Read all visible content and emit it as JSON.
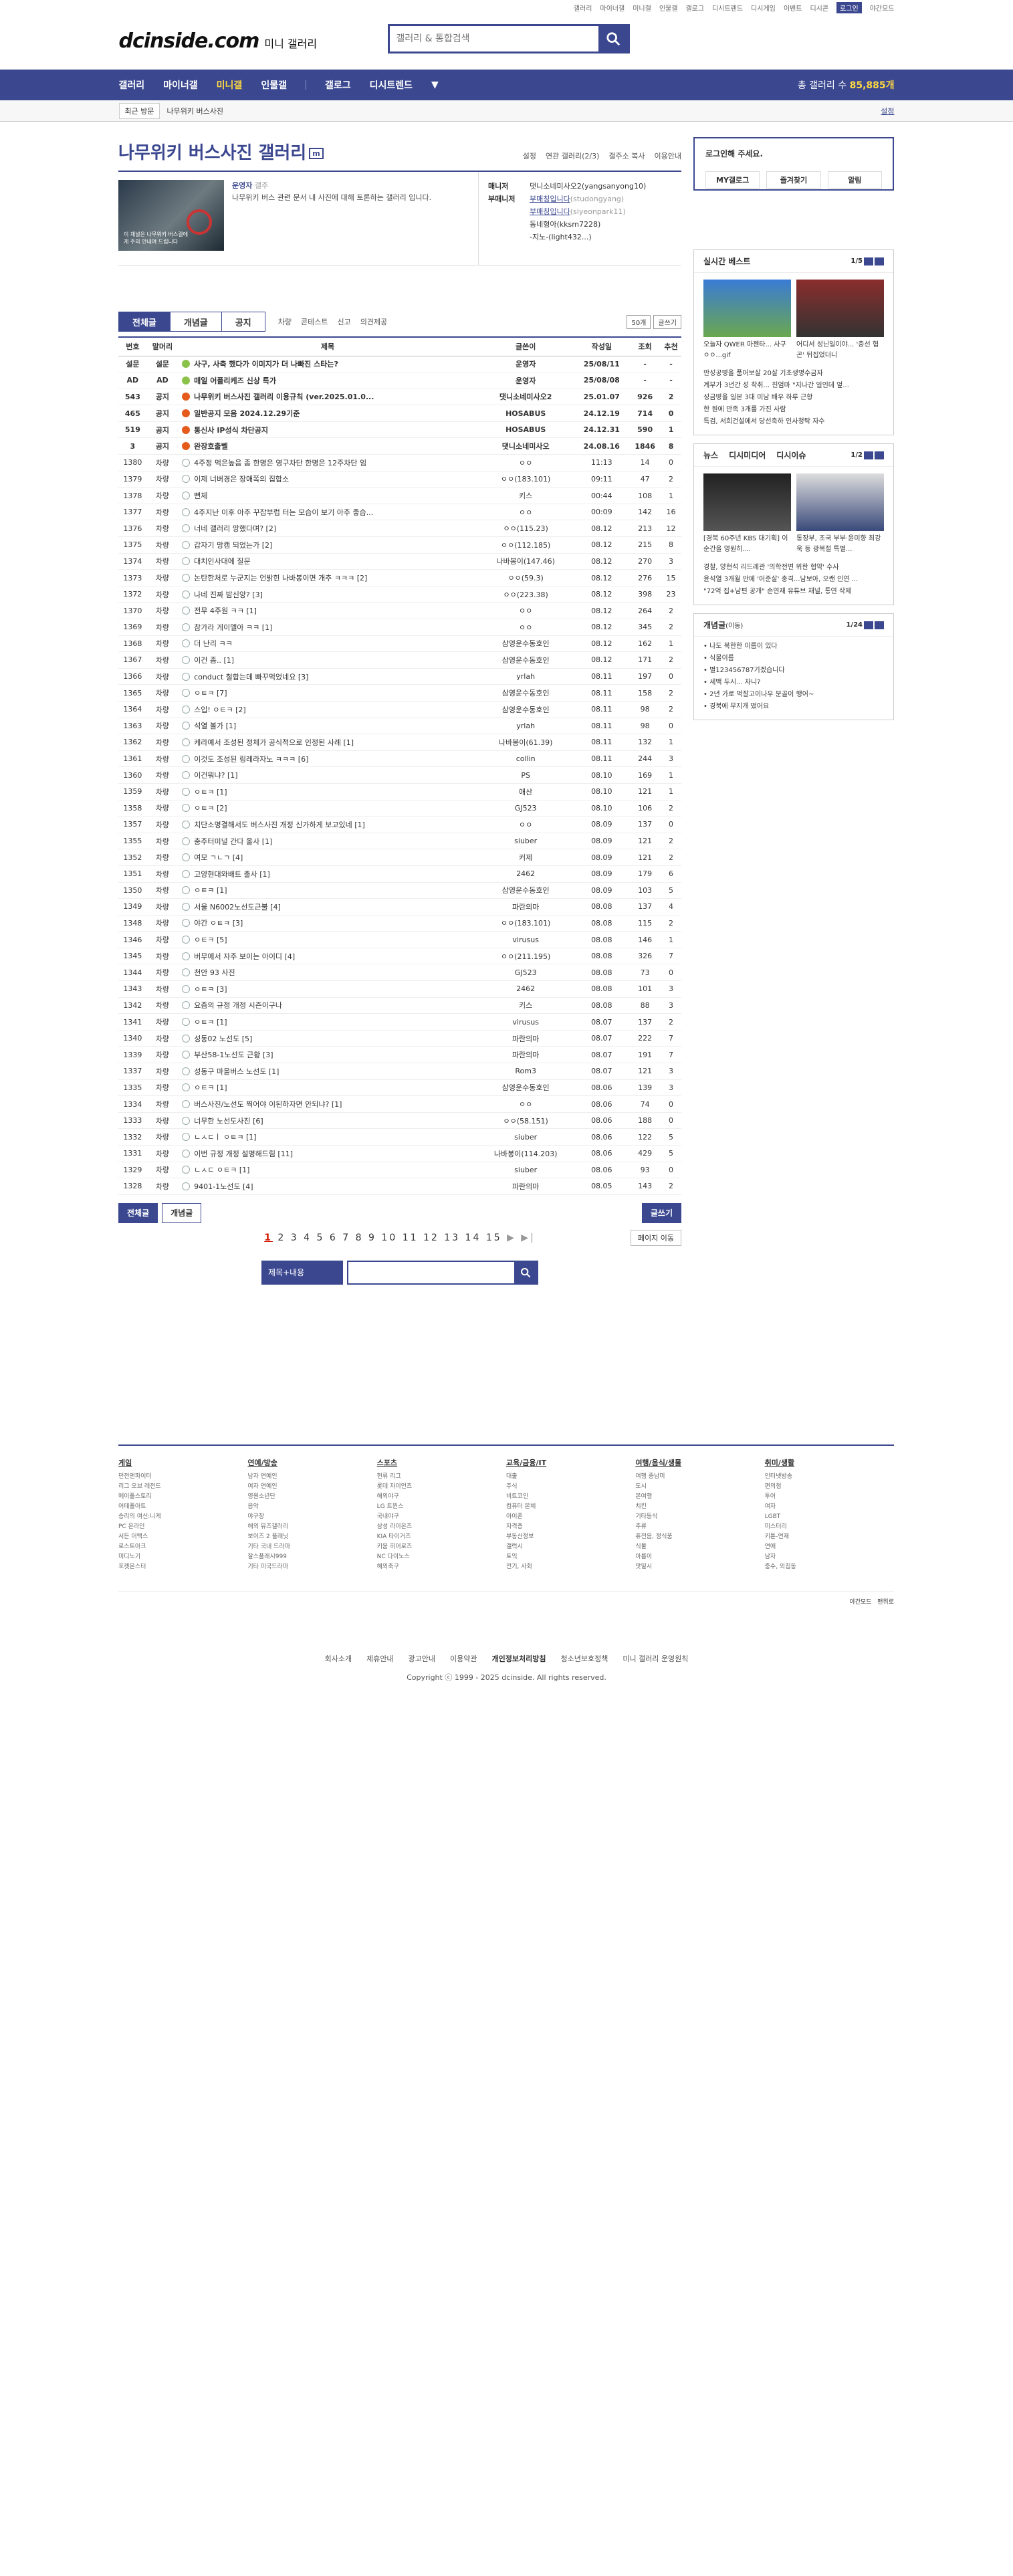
{
  "topbar": {
    "links": [
      "갤러리",
      "마이너갤",
      "미니갤",
      "인물갤",
      "갤로그",
      "디시트렌드",
      "디시게임",
      "이벤트",
      "디시콘"
    ],
    "login": "로그인",
    "night": "야간모드"
  },
  "header": {
    "logo": "dcinside.com",
    "logo_sub": "미니 갤러리",
    "search_placeholder": "갤러리 & 통합검색"
  },
  "gnb": {
    "items": [
      "갤러리",
      "마이너갤",
      "미니갤",
      "인물갤",
      "갤로그",
      "디시트렌드"
    ],
    "active": 2,
    "count_label": "총 갤러리 수",
    "count": "85,885개"
  },
  "crumb": {
    "recent": "최근 방문",
    "current": "나무위키 버스사진",
    "setting": "설정"
  },
  "gallery": {
    "title": "나무위키 버스사진 갤러리",
    "mini": "m",
    "tools": [
      "설정",
      "연관 갤러리(2/3)",
      "갤주소 복사",
      "이용안내"
    ],
    "manager_label": "운영자",
    "manager_sub": "갤주",
    "desc": "나무위키 버스 관련 문서 내 사진에 대해 토론하는 갤러리 입니다.",
    "thumb_caption": "이 채널은 나무위키 버스갤에게 주의 안내여 드립니다",
    "staff": {
      "manager_label": "매니저",
      "manager": "댓니소네미사오2(yangsanyong10)",
      "sub_label": "부매니저",
      "subs": [
        "부매칭입니다",
        "부매칭입니다",
        "동네형아(kksm7228)",
        "-지노-(light432...)"
      ],
      "sub_ids": [
        "(studongyang)",
        "(siyeonpark11)"
      ]
    }
  },
  "tabs": {
    "items": [
      "전체글",
      "개념글",
      "공지"
    ],
    "sub": [
      "차량",
      "콘테스트",
      "신고",
      "의견제공"
    ],
    "per_page": "50개",
    "write": "글쓰기"
  },
  "table": {
    "headers": [
      "번호",
      "말머리",
      "제목",
      "글쓴이",
      "작성일",
      "조회",
      "추천"
    ],
    "rows": [
      [
        "설문",
        "설문",
        "사구, 사축 했다가 이미지가 더 나빠진 스타는?",
        "운영자",
        "25/08/11",
        "-",
        "-",
        "n",
        "#8bc34a"
      ],
      [
        "AD",
        "AD",
        "매일 어플리케즈 신상 특가",
        "운영자",
        "25/08/08",
        "-",
        "-",
        "n",
        "#8bc34a"
      ],
      [
        "543",
        "공지",
        "나무위키 버스사진 갤러리 이용규칙 (ver.2025.01.0...",
        "댓니소네미사오2",
        "25.01.07",
        "926",
        "2",
        "n",
        "#e45b1b"
      ],
      [
        "465",
        "공지",
        "일반공지 모음 2024.12.29기준",
        "HOSABUS",
        "24.12.19",
        "714",
        "0",
        "n",
        "#e45b1b"
      ],
      [
        "519",
        "공지",
        "통신사 IP성식 차단공지",
        "HOSABUS",
        "24.12.31",
        "590",
        "1",
        "n",
        "#e45b1b"
      ],
      [
        "3",
        "공지",
        "완장호출벨",
        "댓니소네미사오",
        "24.08.16",
        "1846",
        "8",
        "n",
        "#e45b1b"
      ],
      [
        "1380",
        "차량",
        "4주정 먹은높음 좀 한명은 영구차단 한명은 12주차단 임",
        "ㅇㅇ",
        "11:13",
        "14",
        "0",
        "",
        ""
      ],
      [
        "1379",
        "차량",
        "이제 너버경은 장애쪽의 집합소",
        "ㅇㅇ(183.101)",
        "09:11",
        "47",
        "2",
        "",
        ""
      ],
      [
        "1378",
        "차량",
        "뻔체",
        "키스",
        "00:44",
        "108",
        "1",
        "",
        ""
      ],
      [
        "1377",
        "차량",
        "4주지난 이후 아주 꾸잡부럽 터는 모습이 보기 아주 좋습...",
        "ㅇㅇ",
        "00:09",
        "142",
        "16",
        "",
        ""
      ],
      [
        "1376",
        "차량",
        "너네 갤러리 망했다며? [2]",
        "ㅇㅇ(115.23)",
        "08.12",
        "213",
        "12",
        "",
        ""
      ],
      [
        "1375",
        "차량",
        "갑자기 망캠 되었는가 [2]",
        "ㅇㅇ(112.185)",
        "08.12",
        "215",
        "8",
        "",
        ""
      ],
      [
        "1374",
        "차량",
        "대치인사대에 질문",
        "나바봉이(147.46)",
        "08.12",
        "270",
        "3",
        "",
        ""
      ],
      [
        "1373",
        "차량",
        "논탄한처로 누군지는 언밝힌 나바봉이면 개추 ㅋㅋㅋ [2]",
        "ㅇㅇ(59.3)",
        "08.12",
        "276",
        "15",
        "",
        ""
      ],
      [
        "1372",
        "차량",
        "나네 진짜 밤신앙? [3]",
        "ㅇㅇ(223.38)",
        "08.12",
        "398",
        "23",
        "",
        ""
      ],
      [
        "1370",
        "차량",
        "전무 4주원 ㅋㅋ [1]",
        "ㅇㅇ",
        "08.12",
        "264",
        "2",
        "",
        ""
      ],
      [
        "1369",
        "차량",
        "참가라 게이엘아 ㅋㅋ [1]",
        "ㅇㅇ",
        "08.12",
        "345",
        "2",
        "",
        ""
      ],
      [
        "1368",
        "차량",
        "더 난리 ㅋㅋ",
        "삼영운수동호인",
        "08.12",
        "162",
        "1",
        "",
        ""
      ],
      [
        "1367",
        "차량",
        "이건 좀.. [1]",
        "삼영운수동호인",
        "08.12",
        "171",
        "2",
        "",
        ""
      ],
      [
        "1366",
        "차량",
        "conduct 철합는데 빠꾸먹었네요 [3]",
        "yrlah",
        "08.11",
        "197",
        "0",
        "",
        ""
      ],
      [
        "1365",
        "차량",
        "ㅇㅌㅋ [7]",
        "삼영운수동호인",
        "08.11",
        "158",
        "2",
        "",
        ""
      ],
      [
        "1364",
        "차량",
        "스입! ㅇㅌㅋ [2]",
        "삼영운수동호인",
        "08.11",
        "98",
        "2",
        "",
        ""
      ],
      [
        "1363",
        "차량",
        "석열 볼가 [1]",
        "yrlah",
        "08.11",
        "98",
        "0",
        "",
        ""
      ],
      [
        "1362",
        "차량",
        "케라예서 조성된 정체가 공식적으로 인정된 사례 [1]",
        "나바봉이(61.39)",
        "08.11",
        "132",
        "1",
        "",
        ""
      ],
      [
        "1361",
        "차량",
        "이것도 조성된 링레라자노 ㅋㅋㅋ [6]",
        "collin",
        "08.11",
        "244",
        "3",
        "",
        ""
      ],
      [
        "1360",
        "차량",
        "이건뭐냐? [1]",
        "PS",
        "08.10",
        "169",
        "1",
        "",
        ""
      ],
      [
        "1359",
        "차량",
        "ㅇㅌㅋ [1]",
        "애산",
        "08.10",
        "121",
        "1",
        "",
        ""
      ],
      [
        "1358",
        "차량",
        "ㅇㅌㅋ [2]",
        "GJ523",
        "08.10",
        "106",
        "2",
        "",
        ""
      ],
      [
        "1357",
        "차량",
        "치단소명결해서도 버스사진 개정 신가하게 보고있네 [1]",
        "ㅇㅇ",
        "08.09",
        "137",
        "0",
        "",
        ""
      ],
      [
        "1355",
        "차량",
        "충주터미널 간다 올사 [1]",
        "siuber",
        "08.09",
        "121",
        "2",
        "",
        ""
      ],
      [
        "1352",
        "차량",
        "여모 ㄱㄴㄱ [4]",
        "커제",
        "08.09",
        "121",
        "2",
        "",
        ""
      ],
      [
        "1351",
        "차량",
        "고양현대와배트 출사 [1]",
        "2462",
        "08.09",
        "179",
        "6",
        "",
        ""
      ],
      [
        "1350",
        "차량",
        "ㅇㅌㅋ [1]",
        "삼영운수동호인",
        "08.09",
        "103",
        "5",
        "",
        ""
      ],
      [
        "1349",
        "차량",
        "서울 N6002노선도근불 [4]",
        "파란의마",
        "08.08",
        "137",
        "4",
        "",
        ""
      ],
      [
        "1348",
        "차량",
        "야간 ㅇㅌㅋ [3]",
        "ㅇㅇ(183.101)",
        "08.08",
        "115",
        "2",
        "",
        ""
      ],
      [
        "1346",
        "차량",
        "ㅇㅌㅋ [5]",
        "virusus",
        "08.08",
        "146",
        "1",
        "",
        ""
      ],
      [
        "1345",
        "차량",
        "버무에서 자주 보이는 아이디 [4]",
        "ㅇㅇ(211.195)",
        "08.08",
        "326",
        "7",
        "",
        ""
      ],
      [
        "1344",
        "차량",
        "천안 93 사진",
        "GJ523",
        "08.08",
        "73",
        "0",
        "",
        ""
      ],
      [
        "1343",
        "차량",
        "ㅇㅌㅋ [3]",
        "2462",
        "08.08",
        "101",
        "3",
        "",
        ""
      ],
      [
        "1342",
        "차량",
        "요즘의 규정 개정 시즌이구나",
        "키스",
        "08.08",
        "88",
        "3",
        "",
        ""
      ],
      [
        "1341",
        "차량",
        "ㅇㅌㅋ [1]",
        "virusus",
        "08.07",
        "137",
        "2",
        "",
        ""
      ],
      [
        "1340",
        "차량",
        "성동02 노선도 [5]",
        "파란의마",
        "08.07",
        "222",
        "7",
        "",
        ""
      ],
      [
        "1339",
        "차량",
        "부산58-1노선도 근황 [3]",
        "파란의마",
        "08.07",
        "191",
        "7",
        "",
        ""
      ],
      [
        "1337",
        "차량",
        "성동구 마을버스 노선도 [1]",
        "Rom3",
        "08.07",
        "121",
        "3",
        "",
        ""
      ],
      [
        "1335",
        "차량",
        "ㅇㅌㅋ [1]",
        "삼영운수동호인",
        "08.06",
        "139",
        "3",
        "",
        ""
      ],
      [
        "1334",
        "차량",
        "버스사진/노선도 찍어야 이된하자면 안되냐? [1]",
        "ㅇㅇ",
        "08.06",
        "74",
        "0",
        "",
        ""
      ],
      [
        "1333",
        "차량",
        "너무한 노선도사진 [6]",
        "ㅇㅇ(58.151)",
        "08.06",
        "188",
        "0",
        "",
        ""
      ],
      [
        "1332",
        "차량",
        "ㄴㅅㄷㅣ ㅇㅌㅋ [1]",
        "siuber",
        "08.06",
        "122",
        "5",
        "",
        ""
      ],
      [
        "1331",
        "차량",
        "이번 규정 개정 설명해드림 [11]",
        "나바봉이(114.203)",
        "08.06",
        "429",
        "5",
        "",
        ""
      ],
      [
        "1329",
        "차량",
        "ㄴㅅㄷ ㅇㅌㅋ [1]",
        "siuber",
        "08.06",
        "93",
        "0",
        "",
        ""
      ],
      [
        "1328",
        "차량",
        "9401-1노선도 [4]",
        "파란의마",
        "08.05",
        "143",
        "2",
        "",
        ""
      ]
    ]
  },
  "bottom": {
    "all": "전체글",
    "concept": "개념글",
    "write": "글쓰기",
    "pages": [
      "1",
      "2",
      "3",
      "4",
      "5",
      "6",
      "7",
      "8",
      "9",
      "10",
      "11",
      "12",
      "13",
      "14",
      "15"
    ],
    "next": "▶ ▶|",
    "move": "페이지 이동",
    "search_sel": "제목+내용"
  },
  "side": {
    "login_msg": "로그인해 주세요.",
    "login_links": [
      "MY갤로그",
      "즐겨찾기",
      "알림"
    ],
    "live_title": "실시간 베스트",
    "live_pg": "1/5",
    "live_caps": [
      "오늘자 QWER 마젠타... 사구 ㅇㅇ...gif",
      "어디서 성닌일이야... '충선 협곤' 뒤집었더니"
    ],
    "live_list": [
      "만성공병을 품어보살 20살 기초생명수금자",
      "계부가 3년간 성 착취... 친엄마 \"지나간 일인데 엎...",
      "성금병을 일본 3대 미남 배우 하루 근황",
      "한 원에 만족 3개를 가진 사람",
      "특검, 서희건설에서 당선축하 인사청탁 자수"
    ],
    "news_tabs": [
      "뉴스",
      "디시미디어",
      "디시이슈"
    ],
    "news_pg": "1/2",
    "news_caps": [
      "[경북 60주년 KBS 대기획] 이 순간을 영원히....",
      "통장부, 조국 부부·윤미향 최강욱 등 광복절 특별..."
    ],
    "news_list": [
      "경찰, 양현석 리드레관 '의학전면 위한 협약' 수사",
      "윤석열 3개월 만에 '어준살' 충격...남보아, 오랜 인연 ...",
      "\"72억 집+남편 공개\" 손연재 유튜브 채널, 통연 삭제"
    ],
    "concept_title": "개념글",
    "concept_sub": "(이동)",
    "concept_pg": "1/24",
    "concept_list": [
      "나도 북한한 이름이 있다",
      "식물이름",
      "별123456787기겠습니다",
      "세백 두시... 자니?",
      "2년 가로 먹잘고이나우 분골이 행어~",
      "경북에 무지개 떴어요"
    ]
  },
  "footer": {
    "cols": [
      {
        "h": "게임",
        "items": [
          "던전앤파이터",
          "리그 오브 레전드",
          "메이플스토리",
          "어테폴아트",
          "승리의 여신:니케",
          "PC 온라인",
          "서든 어택스",
          "로스트아크",
          "미디노기",
          "포켓온스터"
        ]
      },
      {
        "h": "연예/방송",
        "items": [
          "남자 연예인",
          "여자 연예인",
          "영원소년단",
          "음악",
          "야구장",
          "해외 뮤즈갤러리",
          "보이즈 2 플래닛",
          "기타 국내 드라마",
          "잘스플래시999",
          "기타 미국드라마"
        ]
      },
      {
        "h": "스포츠",
        "items": [
          "헌류 리그",
          "롯데 자이언츠",
          "해외야구",
          "LG 트윈스",
          "국내야구",
          "삼성 라이온즈",
          "KIA 타이거즈",
          "키움 히어로즈",
          "NC 다이노스",
          "해외축구"
        ]
      },
      {
        "h": "교육/금융/IT",
        "items": [
          "대출",
          "주식",
          "비트코인",
          "컴퓨터 본체",
          "아이폰",
          "자격증",
          "부동산정보",
          "갤럭시",
          "토익",
          "전기, 사회"
        ]
      },
      {
        "h": "여행/음식/생물",
        "items": [
          "여행 중남미",
          "도시",
          "본여행",
          "치킨",
          "기타동식",
          "주류",
          "퓨전음, 정식품",
          "식물",
          "아름이",
          "맛밑시"
        ]
      },
      {
        "h": "취미/생활",
        "items": [
          "인터넷방송",
          "편의점",
          "투어",
          "여자",
          "LGBT",
          "미스터리",
          "키툰-연재",
          "연애",
          "남자",
          "중수, 외침동"
        ]
      }
    ],
    "ctl": [
      "야간모드",
      "맨위로"
    ],
    "links": [
      "회사소개",
      "제휴안내",
      "광고안내",
      "이용약관",
      "개인정보처리방침",
      "청소년보호정책",
      "미니 갤러리 운영원칙"
    ],
    "copy": "Copyright ⓒ 1999 - 2025 dcinside. All rights reserved."
  }
}
